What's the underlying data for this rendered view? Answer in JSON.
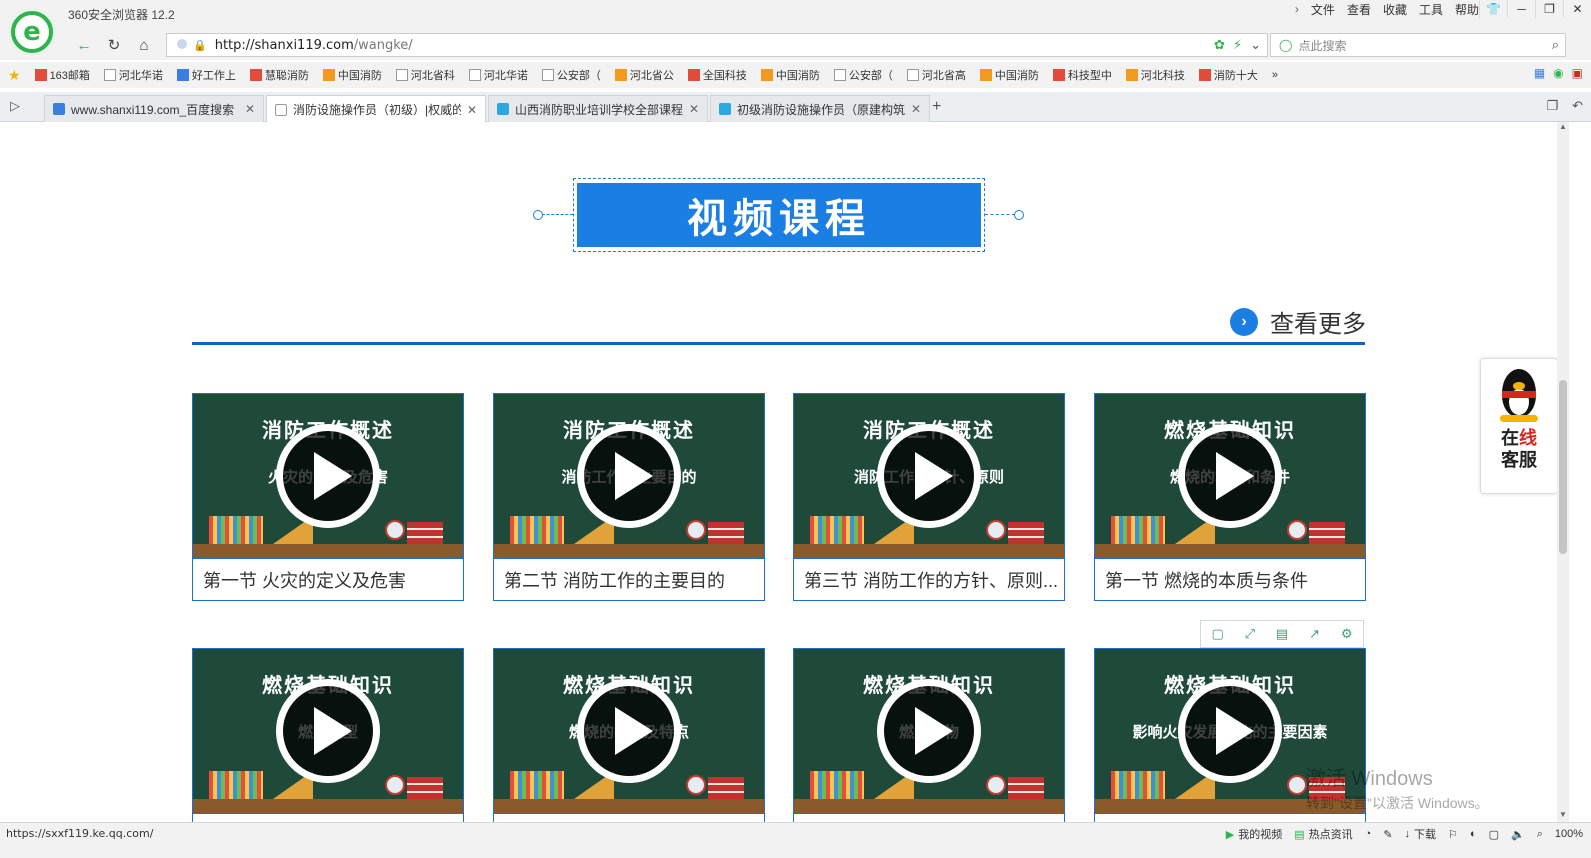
{
  "browser": {
    "title": "360安全浏览器 12.2",
    "menu": [
      "文件",
      "查看",
      "收藏",
      "工具",
      "帮助"
    ],
    "url": "http://shanxi119.com/wangke/",
    "url_host": "http://shanxi119.com",
    "url_path": "/wangke/",
    "search_placeholder": "点此搜索",
    "bookmarks": [
      "163邮箱",
      "河北华诺",
      "好工作上",
      "慧聪消防",
      "中国消防",
      "河北省科",
      "河北华诺",
      "公安部（",
      "河北省公",
      "全国科技",
      "中国消防",
      "公安部（",
      "河北省高",
      "中国消防",
      "科技型中",
      "河北科技",
      "消防十大"
    ],
    "tabs": [
      {
        "title": "www.shanxi119.com_百度搜索",
        "active": false,
        "color": "#3a7ee0"
      },
      {
        "title": "消防设施操作员（初级）|权威的",
        "active": true,
        "color": "#cfcfcf"
      },
      {
        "title": "山西消防职业培训学校全部课程_",
        "active": false,
        "color": "#2aa8e0"
      },
      {
        "title": "初级消防设施操作员（原建构筑",
        "active": false,
        "color": "#2aa8e0"
      }
    ],
    "status_url": "https://sxxf119.ke.qq.com/",
    "status_items": [
      "我的视频",
      "热点资讯",
      "下载",
      "100%"
    ]
  },
  "page": {
    "section_title": "视频课程",
    "more_label": "查看更多",
    "courses": [
      {
        "heading": "消防工作概述",
        "sub": "火灾的定义及危害",
        "title": "第一节 火灾的定义及危害"
      },
      {
        "heading": "消防工作概述",
        "sub": "消防工作的主要目的",
        "title": "第二节 消防工作的主要目的"
      },
      {
        "heading": "消防工作概述",
        "sub": "消防工作的方针、原则",
        "title": "第三节 消防工作的方针、原则..."
      },
      {
        "heading": "燃烧基础知识",
        "sub": "燃烧的本质和条件",
        "title": "第一节 燃烧的本质与条件"
      },
      {
        "heading": "燃烧基础知识",
        "sub": "燃烧类型",
        "title": ""
      },
      {
        "heading": "燃烧基础知识",
        "sub": "燃烧的类型及特点",
        "title": ""
      },
      {
        "heading": "燃烧基础知识",
        "sub": "燃烧产物",
        "title": ""
      },
      {
        "heading": "燃烧基础知识",
        "sub": "影响火灾发展变化的主要因素",
        "title": ""
      }
    ],
    "qq_line1_a": "在",
    "qq_line1_b": "线",
    "qq_line2": "客服"
  },
  "watermark": {
    "title": "激活 Windows",
    "sub": "转到\"设置\"以激活 Windows。"
  },
  "colors": {
    "brand_blue": "#1a7ee2",
    "rule_blue": "#1565c0",
    "browser_green": "#2fb34c"
  }
}
